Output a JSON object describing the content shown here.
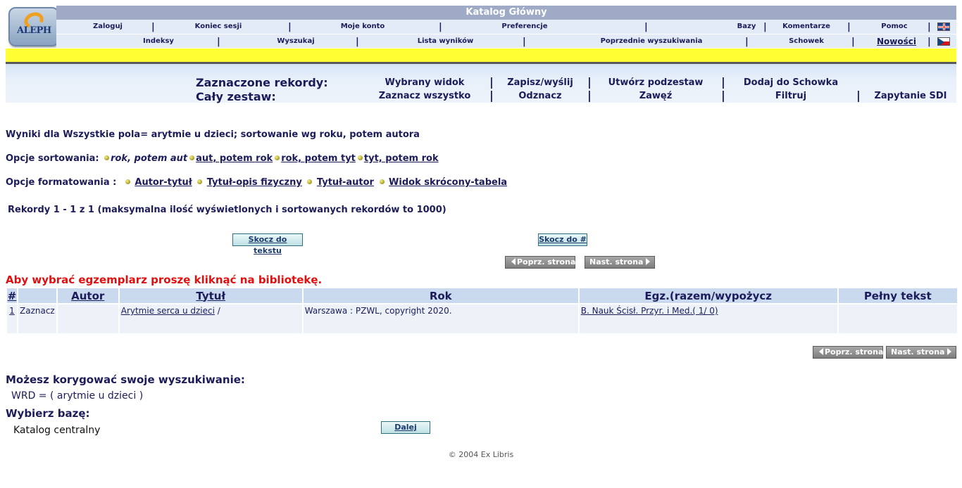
{
  "header": {
    "title": "Katalog Główny",
    "logo_text": "ALEPH",
    "nav1": [
      "Zaloguj",
      "Koniec sesji",
      "Moje konto",
      "Preferencje",
      "Bazy",
      "Komentarze",
      "Pomoc"
    ],
    "nav2": [
      "Indeksy",
      "Wyszukaj",
      "Lista wyników",
      "Poprzednie wyszukiwania",
      "Schowek",
      "Nowości"
    ],
    "separator": "|",
    "flags": [
      "flag-uk-icon",
      "flag-cz-icon"
    ]
  },
  "selection": {
    "marked_label": "Zaznaczone rekordy:",
    "whole_label": "Cały zestaw:",
    "marked_actions": [
      "Wybrany widok",
      "Zapisz/wyślij",
      "Utwórz podzestaw",
      "Dodaj do Schowka"
    ],
    "whole_actions": [
      "Zaznacz wszystko",
      "Odznacz",
      "Zawęź",
      "Filtruj",
      "Zapytanie SDI"
    ]
  },
  "results_info": "Wyniki dla Wszystkie pola= arytmie u dzieci; sortowanie wg roku, potem autora",
  "sort": {
    "label": "Opcje sortowania:",
    "current": "rok, potem aut",
    "options": [
      "aut, potem rok",
      "rok, potem tyt",
      "tyt, potem rok"
    ]
  },
  "format": {
    "label": "Opcje formatowania :",
    "options": [
      "Autor-tytuł",
      "Tytuł-opis fizyczny",
      "Tytuł-autor",
      "Widok skrócony-tabela"
    ]
  },
  "records_info": "Rekordy 1 - 1 z 1 (maksymalna ilość wyświetlonych i sortowanych rekordów to 1000)",
  "buttons": {
    "jump_text": "Skocz do tekstu",
    "jump_num": "Skocz do #",
    "prev": "Poprz. strona",
    "next": "Nast. strona",
    "go": "Dalej"
  },
  "pick_message": "Aby wybrać egzemplarz proszę kliknąć na bibliotekę.",
  "table": {
    "headers": [
      "#",
      "",
      "Autor",
      "Tytuł",
      "Rok",
      "Egz.(razem/wypożycz",
      "Pełny tekst"
    ],
    "rows": [
      {
        "num": "1",
        "mark": "Zaznacz",
        "author": "",
        "title": "Arytmie serca u dzieci",
        "title_suffix": " /",
        "year": "Warszawa : PZWL, copyright 2020.",
        "holdings": "B. Nauk Ścisł. Przyr. i Med.( 1/ 0)",
        "fulltext": ""
      }
    ]
  },
  "refine": {
    "title": "Możesz korygować swoje wyszukiwanie:",
    "query": "WRD = ( arytmie u dzieci )"
  },
  "base": {
    "title": "Wybierz bazę:",
    "value": "Katalog centralny"
  },
  "footer": "© 2004 Ex Libris",
  "colors": {
    "title_bar": "#9eaac6",
    "nav_bg": "#e3ebf6",
    "yellow_bar": "#ffff33",
    "warning_red": "#e01010",
    "table_header": "#c9d9ee"
  }
}
